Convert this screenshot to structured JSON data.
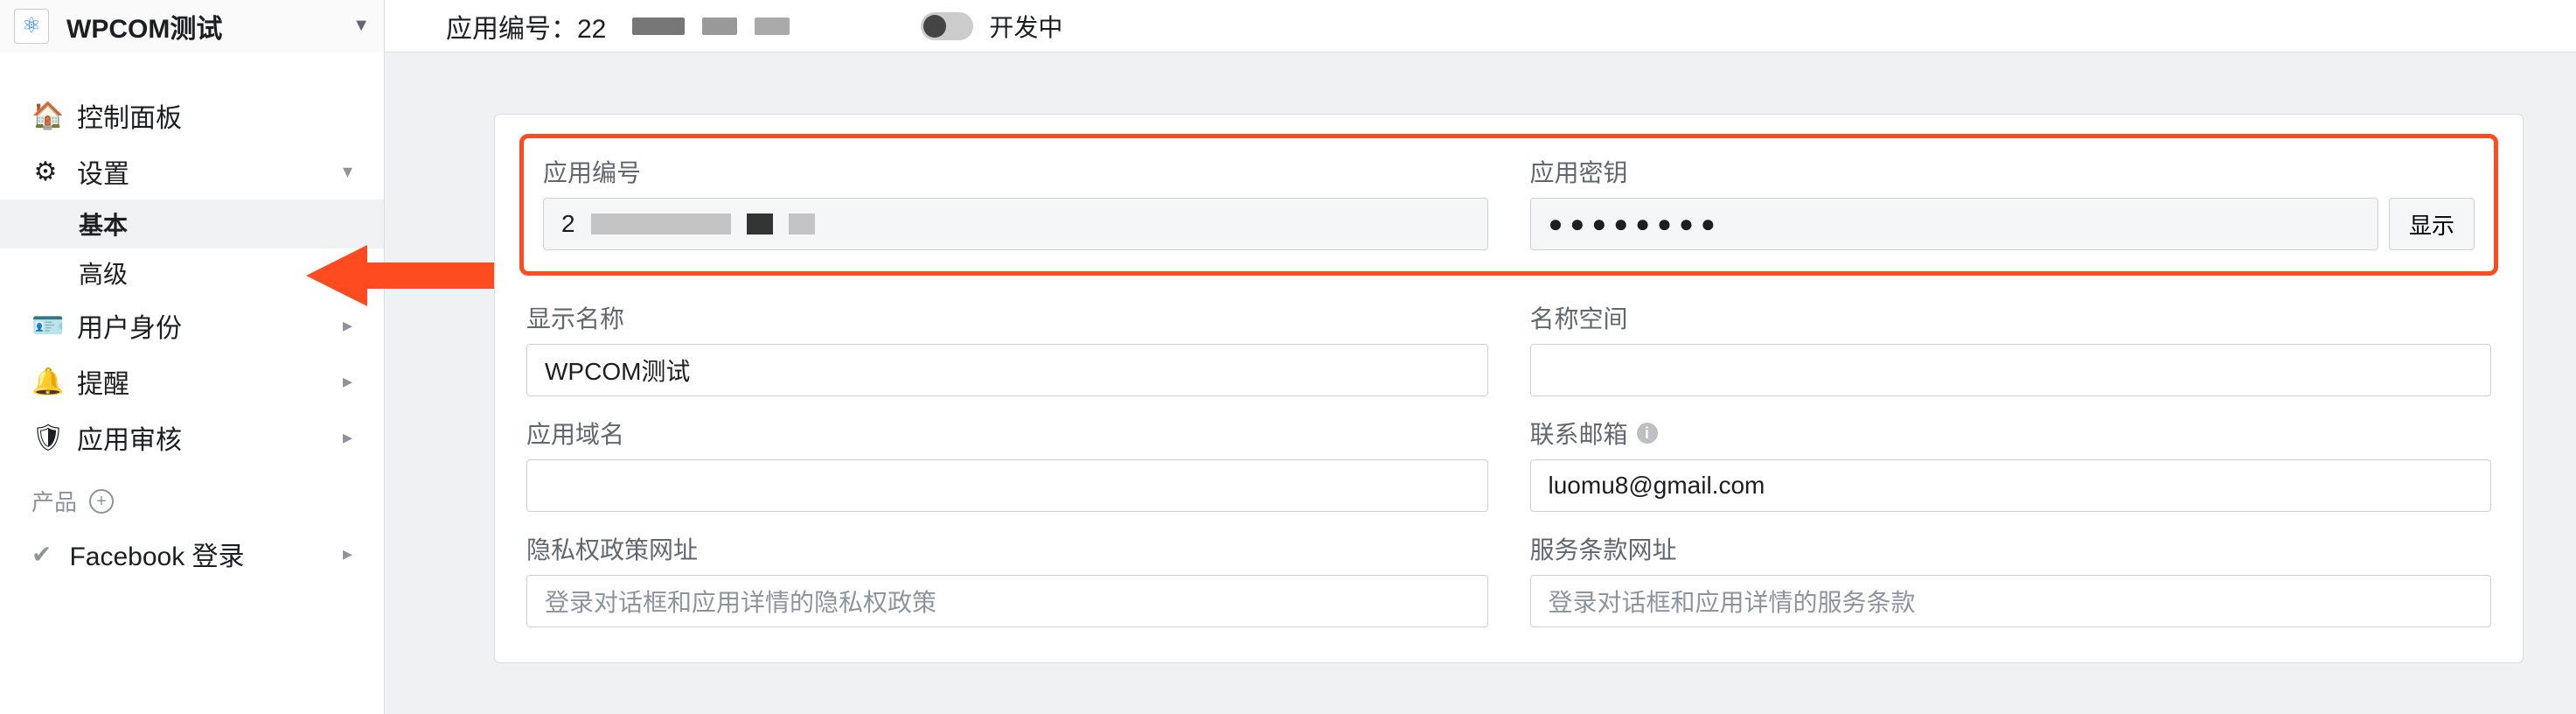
{
  "header": {
    "app_name": "WPCOM测试",
    "app_id_label": "应用编号：",
    "app_id_visible": "22",
    "mode_label": "开发中"
  },
  "sidebar": {
    "dashboard": "控制面板",
    "settings": "设置",
    "settings_basic": "基本",
    "settings_advanced": "高级",
    "user_identity": "用户身份",
    "alerts": "提醒",
    "app_review": "应用审核",
    "products_heading": "产品",
    "facebook_login": "Facebook 登录"
  },
  "panel": {
    "app_id_label": "应用编号",
    "app_id_visible": "2",
    "app_secret_label": "应用密钥",
    "app_secret_masked": "●●●●●●●●",
    "show_button": "显示",
    "display_name_label": "显示名称",
    "display_name_value": "WPCOM测试",
    "namespace_label": "名称空间",
    "namespace_value": "",
    "app_domain_label": "应用域名",
    "app_domain_value": "",
    "contact_email_label": "联系邮箱",
    "contact_email_value": "luomu8@gmail.com",
    "privacy_url_label": "隐私权政策网址",
    "privacy_url_placeholder": "登录对话框和应用详情的隐私权政策",
    "tos_url_label": "服务条款网址",
    "tos_url_placeholder": "登录对话框和应用详情的服务条款"
  }
}
